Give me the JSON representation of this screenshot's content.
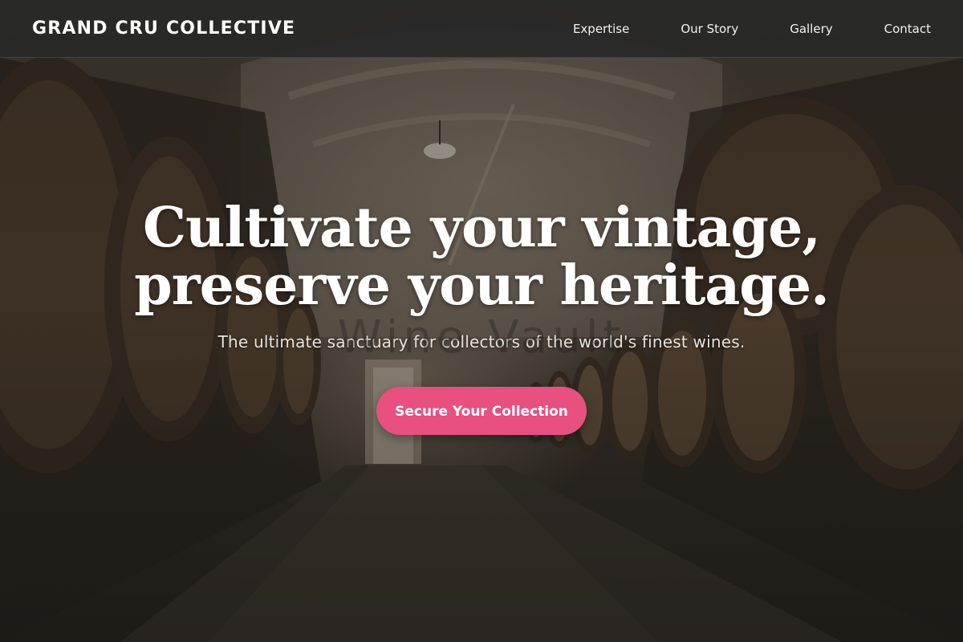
{
  "header": {
    "brand": "GRAND CRU COLLECTIVE",
    "nav": [
      {
        "label": "Expertise"
      },
      {
        "label": "Our Story"
      },
      {
        "label": "Gallery"
      },
      {
        "label": "Contact"
      }
    ]
  },
  "hero": {
    "title_line_1": "Cultivate your vintage,",
    "title_line_2": "preserve your heritage.",
    "subtitle": "The ultimate sanctuary for collectors of the world's finest wines.",
    "cta_label": "Secure Your Collection",
    "background_image": "wine-cellar-barrels",
    "ghost_text": "Wine Vault"
  },
  "colors": {
    "header_bg": "#282828",
    "cta_accent": "#e8507f",
    "text_primary": "#ffffff"
  }
}
